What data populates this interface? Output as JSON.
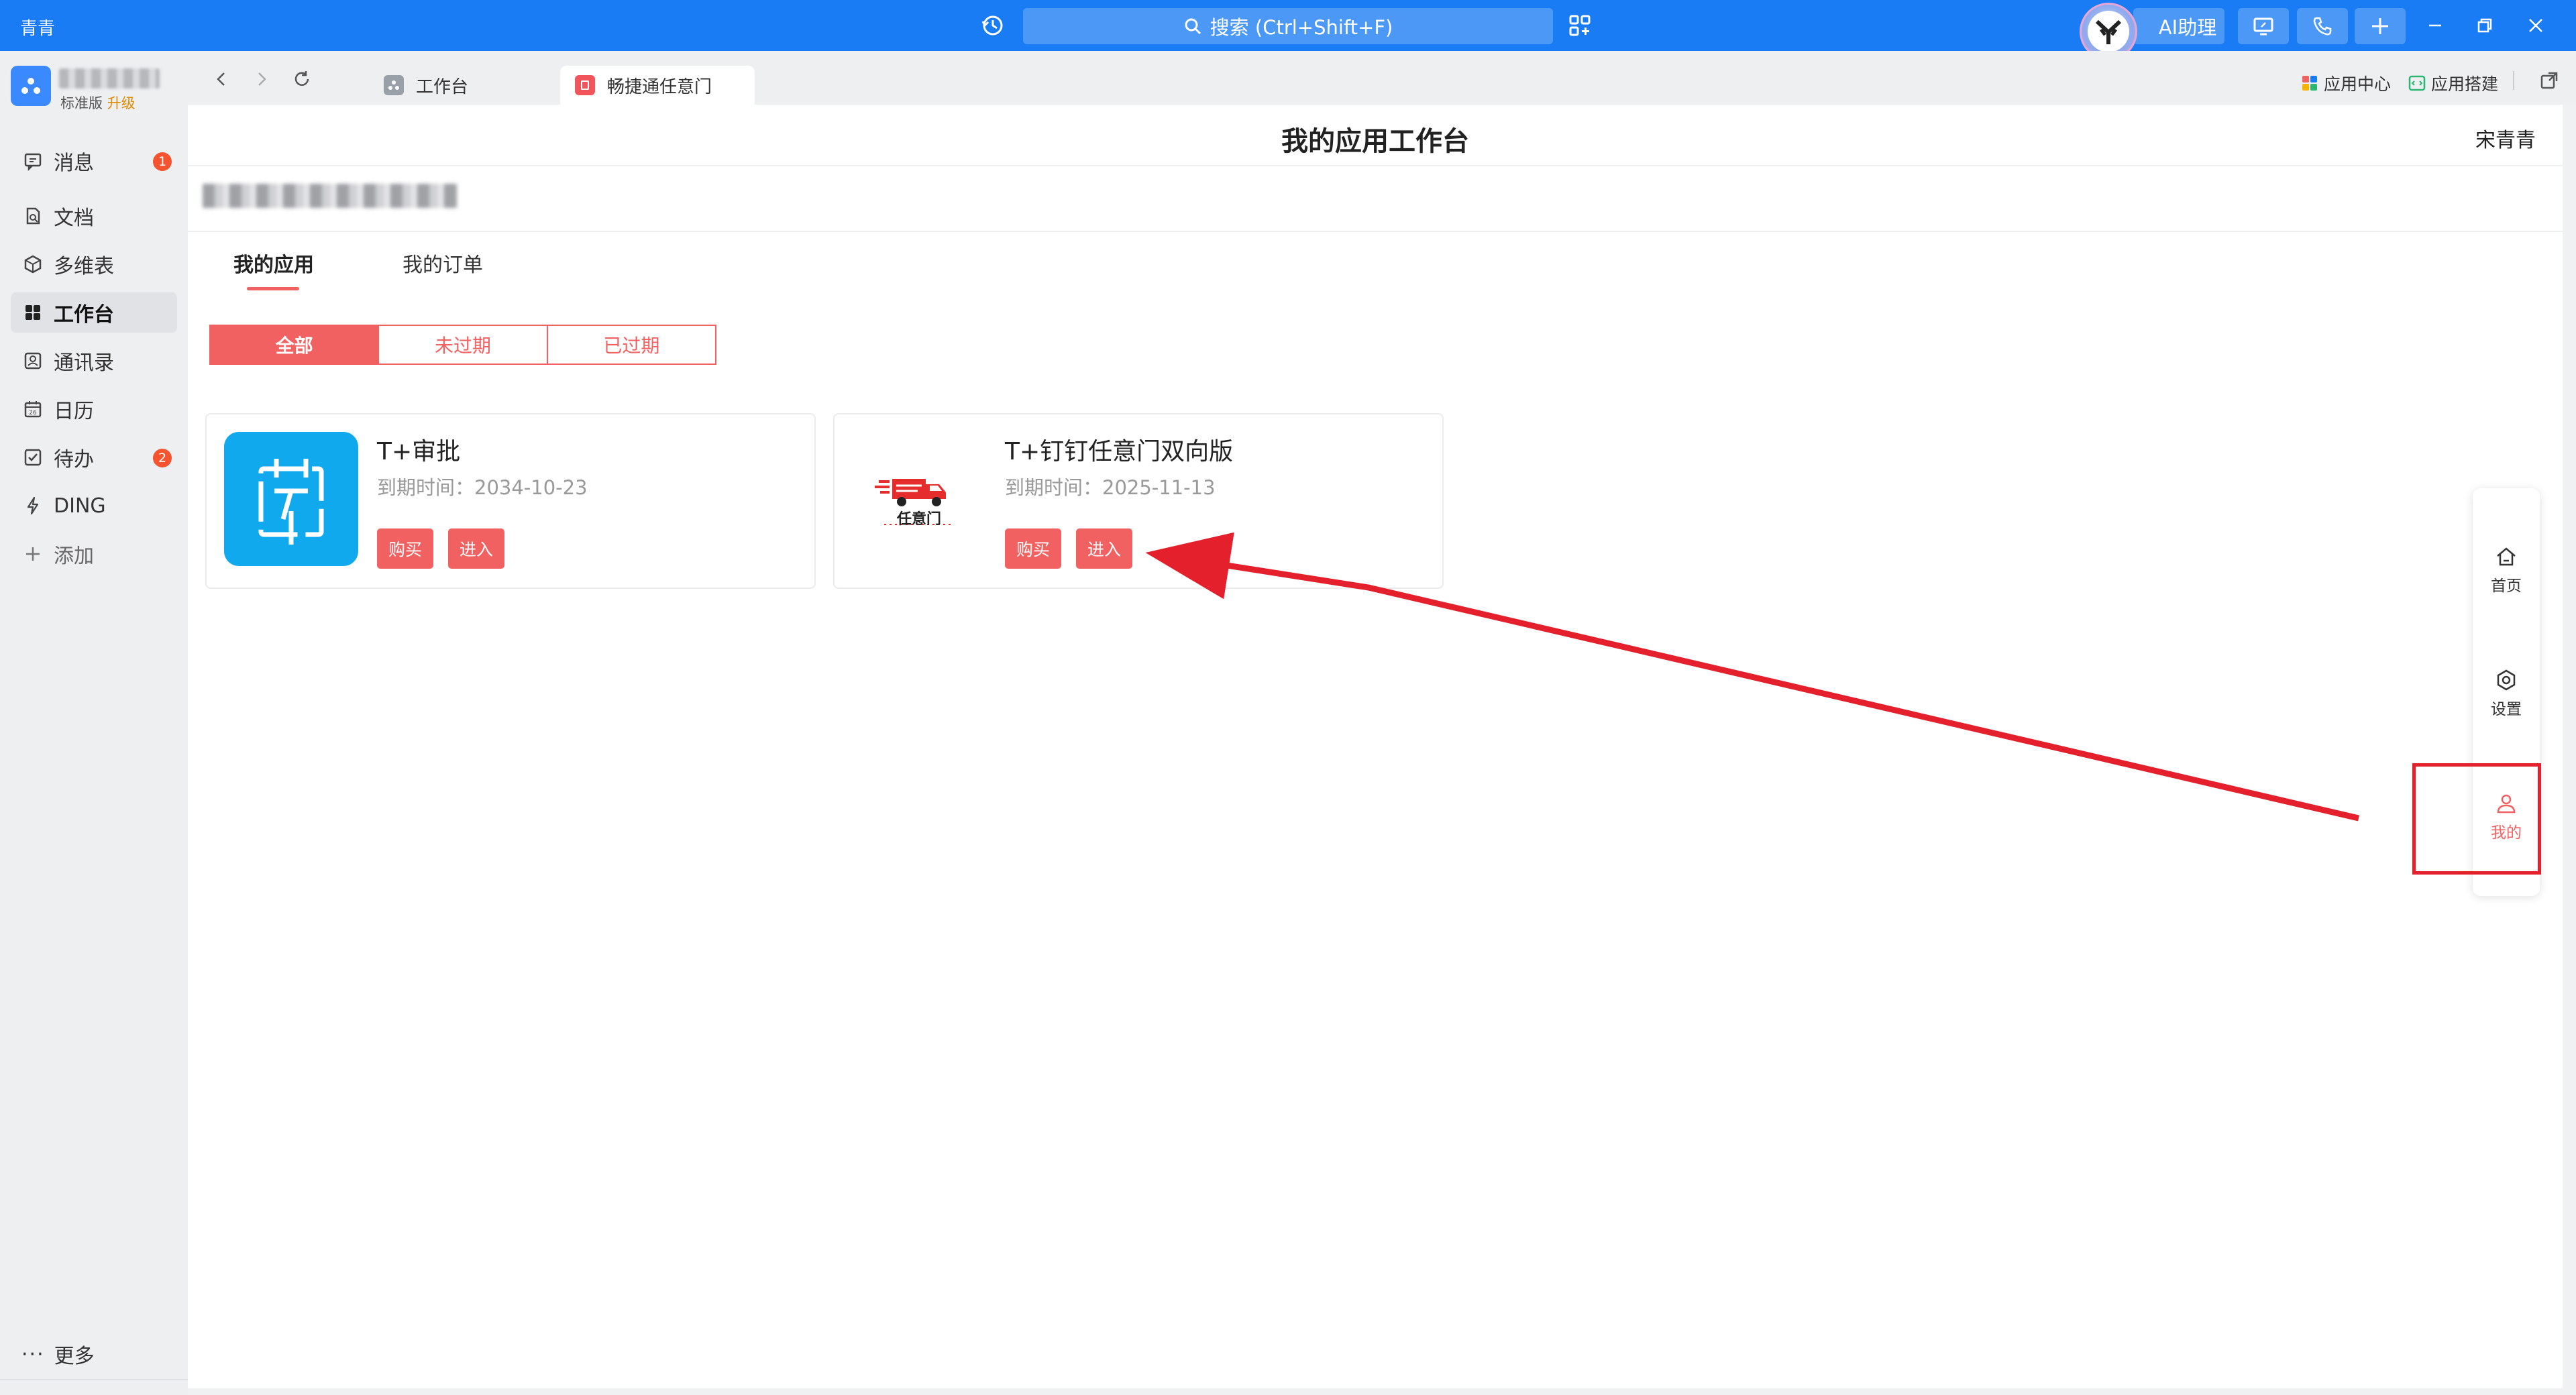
{
  "app": {
    "brand": "青青"
  },
  "search": {
    "placeholder": "搜索 (Ctrl+Shift+F)"
  },
  "ai_assistant": {
    "label": "AI助理"
  },
  "sidebar": {
    "org_plan": "标准版",
    "org_upgrade": "升级",
    "items": [
      {
        "label": "消息",
        "icon": "message-icon",
        "badge": "1"
      },
      {
        "label": "文档",
        "icon": "document-icon"
      },
      {
        "label": "多维表",
        "icon": "table-icon"
      },
      {
        "label": "工作台",
        "icon": "workbench-icon",
        "active": true
      },
      {
        "label": "通讯录",
        "icon": "contacts-icon"
      },
      {
        "label": "日历",
        "icon": "calendar-icon"
      },
      {
        "label": "待办",
        "icon": "todo-icon",
        "badge": "2"
      },
      {
        "label": "DING",
        "icon": "lightning-icon"
      },
      {
        "label": "添加",
        "icon": "plus-icon"
      }
    ],
    "more": "更多"
  },
  "tabs": [
    {
      "label": "工作台"
    },
    {
      "label": "畅捷通任意门",
      "active": true
    }
  ],
  "right_tools": {
    "app_center": "应用中心",
    "app_build": "应用搭建"
  },
  "page": {
    "title": "我的应用工作台",
    "user": "宋青青",
    "content_tabs": [
      "我的应用",
      "我的订单"
    ],
    "filters": [
      "全部",
      "未过期",
      "已过期"
    ]
  },
  "cards": [
    {
      "name": "T+审批",
      "expire": "到期时间：2034-10-23",
      "buy": "购买",
      "enter": "进入"
    },
    {
      "name": "T+钉钉任意门双向版",
      "expire": "到期时间：2025-11-13",
      "buy": "购买",
      "enter": "进入",
      "logo_text": "任意门"
    }
  ],
  "float_panel": {
    "items": [
      {
        "label": "首页",
        "icon": "home-icon"
      },
      {
        "label": "设置",
        "icon": "settings-icon"
      },
      {
        "label": "我的",
        "icon": "user-icon",
        "active": true
      }
    ]
  },
  "colors": {
    "primary_blue": "#1a7cf5",
    "accent_red": "#f26161",
    "annotation_red": "#e4202d"
  }
}
